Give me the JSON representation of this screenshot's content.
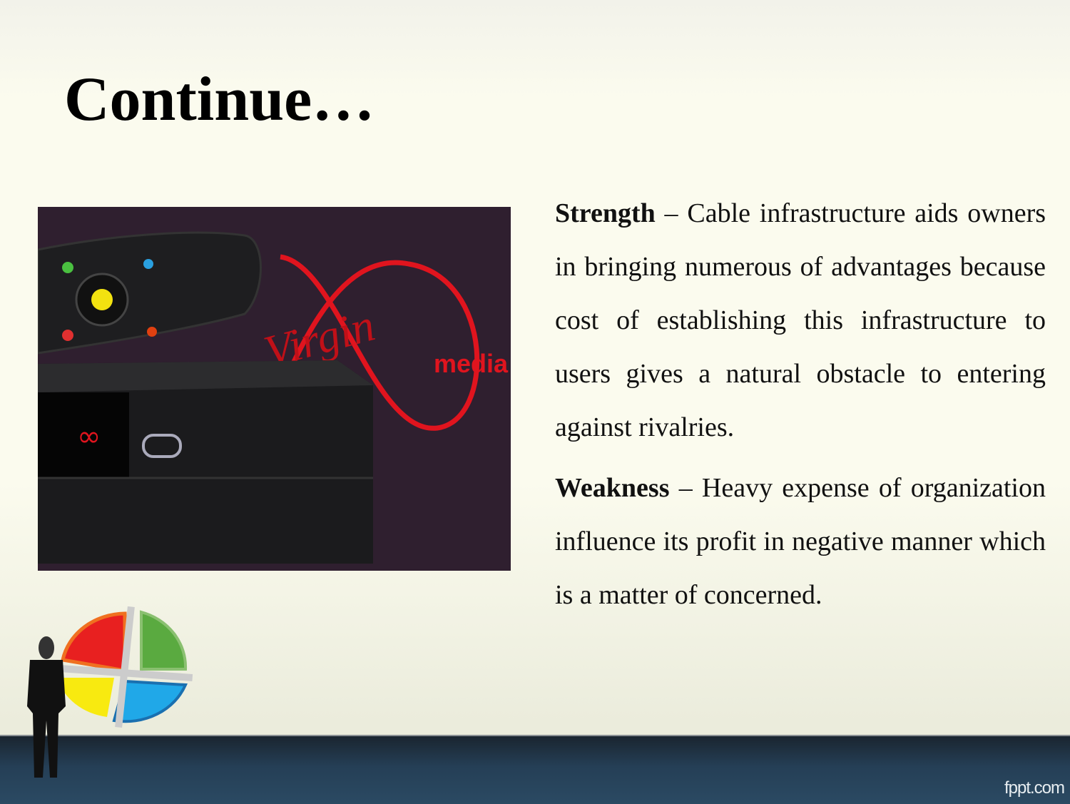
{
  "slide": {
    "title": "Continue…",
    "paragraphs": [
      {
        "term": "Strength",
        "dash": " – ",
        "text": "Cable infrastructure aids owners in bringing numerous of advantages because cost of establishing this infrastructure to users gives a natural obstacle to entering against rivalries."
      },
      {
        "term": "Weakness",
        "dash": " – ",
        "text": "Heavy expense of organization influence its profit in negative manner which is a matter of concerned."
      }
    ],
    "image": {
      "logo_text": "Virgin media"
    },
    "footer": {
      "brand": "fppt.com"
    }
  },
  "colors": {
    "footer": "#2b4a63",
    "brand_red": "#e0141e",
    "title": "#000000"
  }
}
